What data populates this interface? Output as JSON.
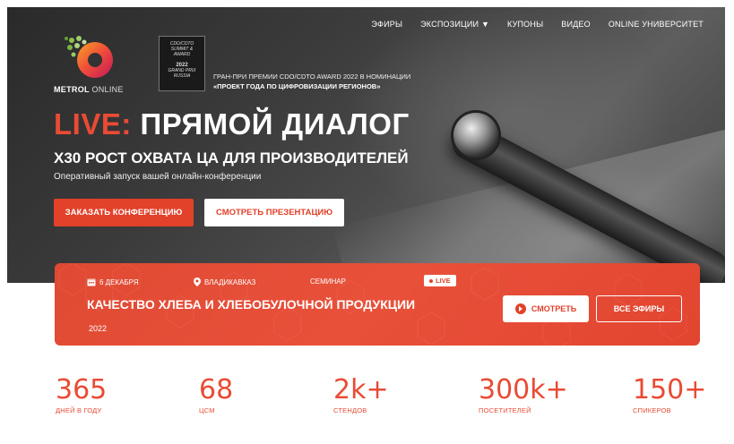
{
  "nav": {
    "items": [
      "ЭФИРЫ",
      "ЭКСПОЗИЦИИ",
      "КУПОНЫ",
      "ВИДЕО",
      "ONLINE УНИВЕРСИТЕТ"
    ]
  },
  "logo": {
    "brand": "METROL",
    "suffix": "ONLINE"
  },
  "award": {
    "badge_line1": "CDO/CDTO",
    "badge_line2": "SUMMIT &",
    "badge_line3": "AWARD",
    "badge_year": "2022",
    "badge_line4": "GRAND PRIX",
    "badge_line5": "RUSSIA",
    "text_line1": "ГРАН-ПРИ ПРЕМИИ CDO/CDTO AWARD 2022 В НОМИНАЦИИ",
    "text_line2": "«ПРОЕКТ ГОДА ПО ЦИФРОВИЗАЦИИ РЕГИОНОВ»"
  },
  "hero": {
    "title_accent": "LIVE:",
    "title_rest": "ПРЯМОЙ ДИАЛОГ",
    "subtitle": "Х30 РОСТ ОХВАТА ЦА ДЛЯ ПРОИЗВОДИТЕЛЕЙ",
    "description": "Оперативный запуск вашей онлайн-конференции",
    "order_button": "ЗАКАЗАТЬ КОНФЕРЕНЦИЮ",
    "presentation_button": "СМОТРЕТЬ ПРЕЗЕНТАЦИЮ"
  },
  "event": {
    "date": "6 ДЕКАБРЯ",
    "city": "ВЛАДИКАВКАЗ",
    "type": "СЕМИНАР",
    "live_label": "LIVE",
    "title": "КАЧЕСТВО ХЛЕБА И ХЛЕБОБУЛОЧНОЙ ПРОДУКЦИИ",
    "year": "2022",
    "watch_button": "СМОТРЕТЬ",
    "all_button": "ВСЕ ЭФИРЫ"
  },
  "stats": [
    {
      "value": "365",
      "label": "ДНЕЙ В ГОДУ"
    },
    {
      "value": "68",
      "label": "ЦСМ"
    },
    {
      "value": "2k+",
      "label": "СТЕНДОВ"
    },
    {
      "value": "300k+",
      "label": "ПОСЕТИТЕЛЕЙ"
    },
    {
      "value": "150+",
      "label": "СПИКЕРОВ"
    }
  ],
  "colors": {
    "accent": "#e94b35",
    "dark": "#2a2a2a"
  }
}
